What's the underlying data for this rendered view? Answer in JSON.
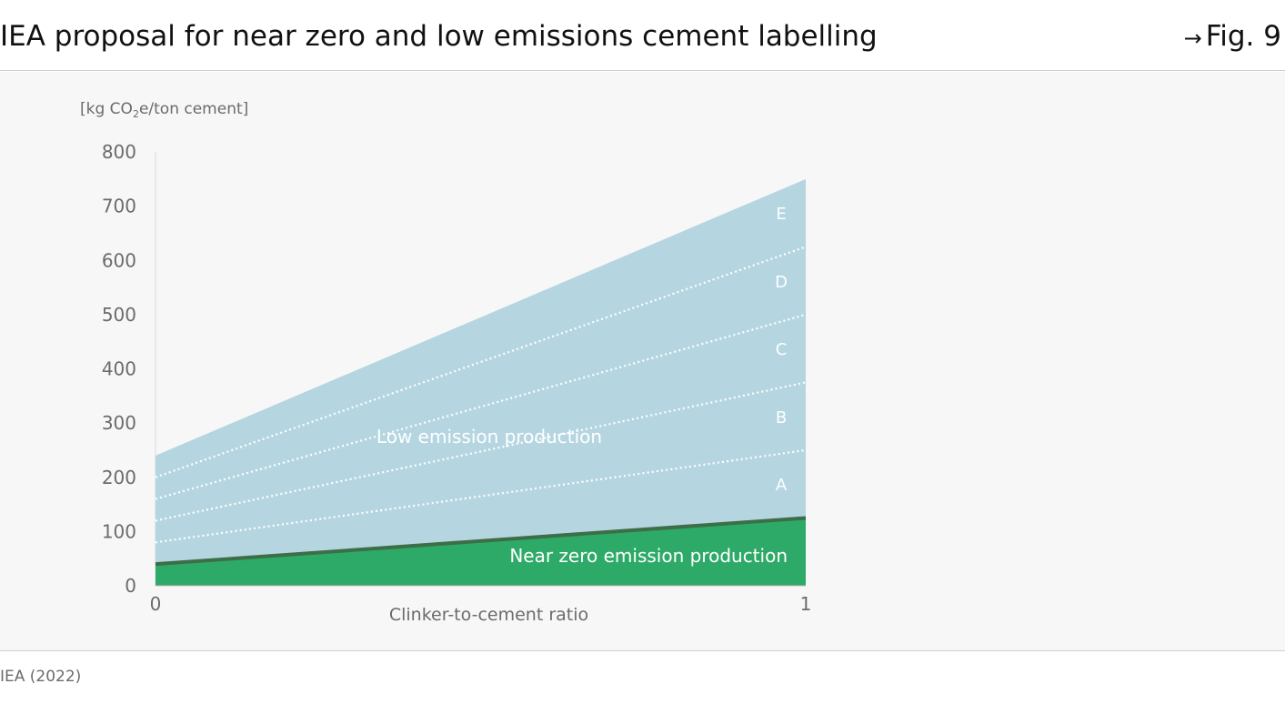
{
  "header": {
    "title": "IEA proposal for near zero and low emissions cement labelling",
    "figure_ref": "Fig. 9"
  },
  "footer": {
    "source": "IEA (2022)"
  },
  "chart_data": {
    "type": "area",
    "ylabel_prefix": "[kg CO",
    "ylabel_sub": "2",
    "ylabel_suffix": "e/ton cement]",
    "xlabel": "Clinker-to-cement ratio",
    "xlim": [
      0,
      1
    ],
    "ylim": [
      0,
      800
    ],
    "x_ticks": [
      "0",
      "1"
    ],
    "y_ticks": [
      "0",
      "100",
      "200",
      "300",
      "400",
      "500",
      "600",
      "700",
      "800"
    ],
    "grid": false,
    "regions": {
      "low_emission": {
        "label": "Low emission production",
        "x": [
          0,
          1
        ],
        "y": [
          240,
          750
        ],
        "color": "#b5d6e1"
      },
      "near_zero": {
        "label": "Near zero emission production",
        "x": [
          0,
          1
        ],
        "y": [
          40,
          125
        ],
        "color": "#2eaa68",
        "edge_color": "#3c6e47"
      }
    },
    "thresholds": [
      {
        "x": [
          0,
          1
        ],
        "y": [
          80,
          250
        ]
      },
      {
        "x": [
          0,
          1
        ],
        "y": [
          120,
          375
        ]
      },
      {
        "x": [
          0,
          1
        ],
        "y": [
          160,
          500
        ]
      },
      {
        "x": [
          0,
          1
        ],
        "y": [
          200,
          625
        ]
      }
    ],
    "classes": [
      {
        "label": "A",
        "y": 188
      },
      {
        "label": "B",
        "y": 312
      },
      {
        "label": "C",
        "y": 438
      },
      {
        "label": "D",
        "y": 562
      },
      {
        "label": "E",
        "y": 688
      }
    ]
  }
}
